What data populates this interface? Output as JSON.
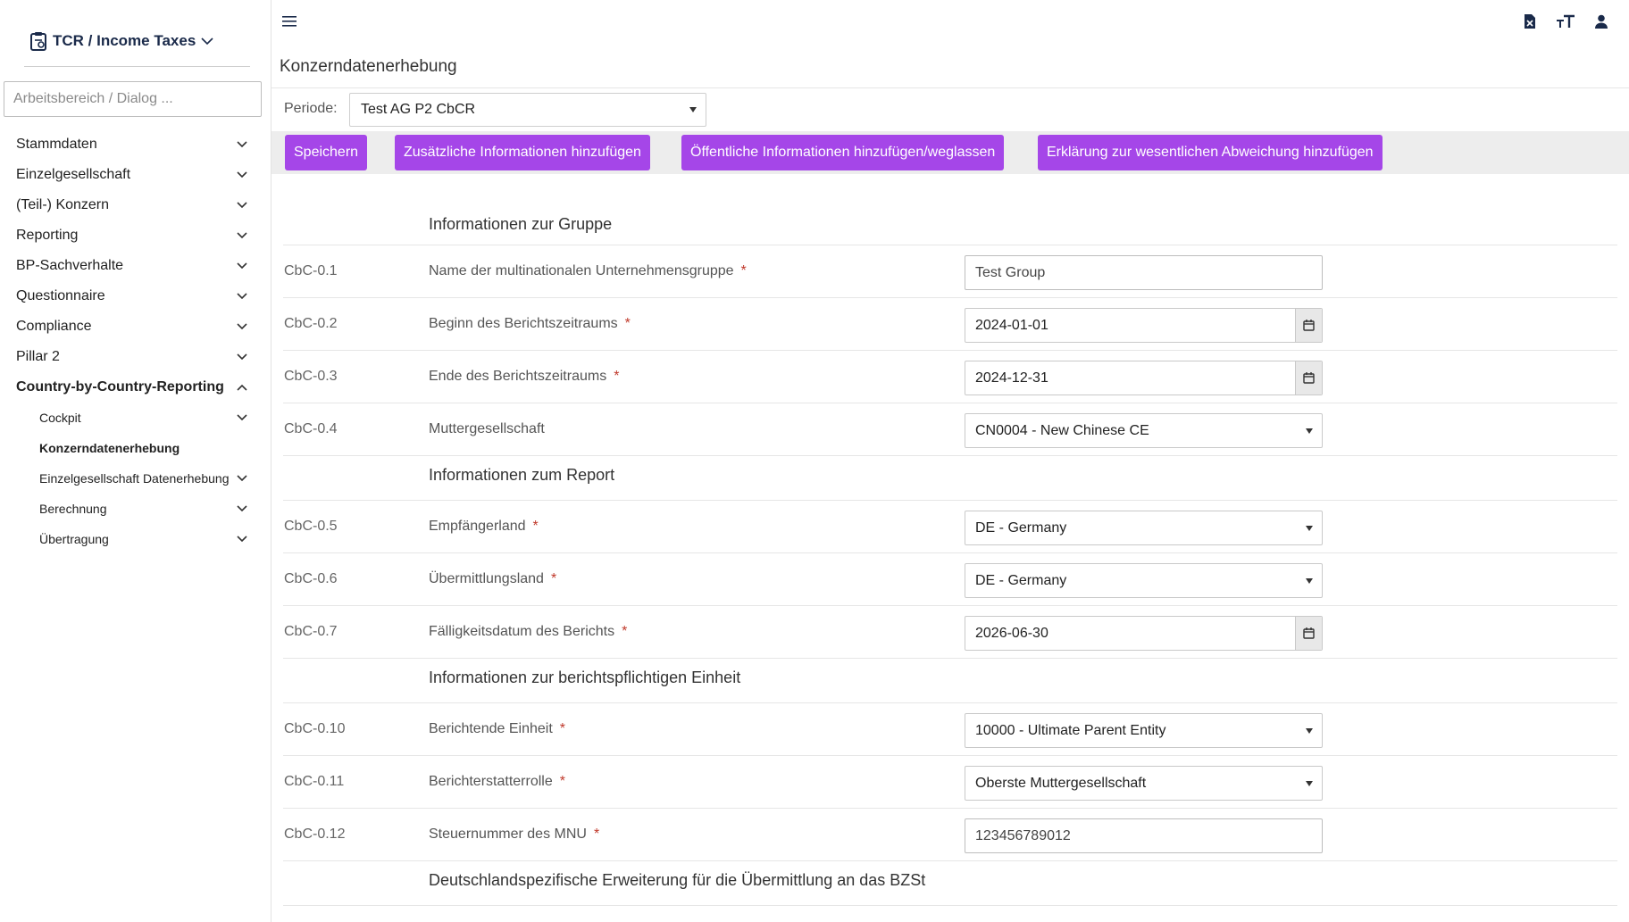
{
  "sidebar": {
    "app_title": "TCR / Income Taxes",
    "search_placeholder": "Arbeitsbereich / Dialog ...",
    "items": [
      {
        "label": "Stammdaten",
        "expanded": false
      },
      {
        "label": "Einzelgesellschaft",
        "expanded": false
      },
      {
        "label": "(Teil-) Konzern",
        "expanded": false
      },
      {
        "label": "Reporting",
        "expanded": false
      },
      {
        "label": "BP-Sachverhalte",
        "expanded": false
      },
      {
        "label": "Questionnaire",
        "expanded": false
      },
      {
        "label": "Compliance",
        "expanded": false
      },
      {
        "label": "Pillar 2",
        "expanded": false
      },
      {
        "label": "Country-by-Country-Reporting",
        "expanded": true
      }
    ],
    "sub_items": [
      {
        "label": "Cockpit"
      },
      {
        "label": "Konzerndatenerhebung"
      },
      {
        "label": "Einzelgesellschaft Datenerhebung"
      },
      {
        "label": "Berechnung"
      },
      {
        "label": "Übertragung"
      }
    ]
  },
  "header": {
    "page_title": "Konzerndatenerhebung",
    "periode_label": "Periode:",
    "periode_value": "Test AG P2 CbCR"
  },
  "toolbar": {
    "save": "Speichern",
    "additional_info": "Zusätzliche Informationen hinzufügen",
    "public_info": "Öffentliche Informationen hinzufügen/weglassen",
    "deviation": "Erklärung zur wesentlichen Abweichung hinzufügen"
  },
  "form": {
    "sections": {
      "group": "Informationen zur Gruppe",
      "report": "Informationen zum Report",
      "entity": "Informationen zur berichtspflichtigen Einheit",
      "germany": "Deutschlandspezifische Erweiterung für die Übermittlung an das BZSt"
    },
    "required_mark": "*",
    "rows": {
      "r01": {
        "code": "CbC-0.1",
        "label": "Name der multinationalen Unternehmensgruppe",
        "value": "Test Group"
      },
      "r02": {
        "code": "CbC-0.2",
        "label": "Beginn des Berichtszeitraums",
        "value": "2024-01-01"
      },
      "r03": {
        "code": "CbC-0.3",
        "label": "Ende des Berichtszeitraums",
        "value": "2024-12-31"
      },
      "r04": {
        "code": "CbC-0.4",
        "label": "Muttergesellschaft",
        "value": "CN0004 - New Chinese CE"
      },
      "r05": {
        "code": "CbC-0.5",
        "label": "Empfängerland",
        "value": "DE - Germany"
      },
      "r06": {
        "code": "CbC-0.6",
        "label": "Übermittlungsland",
        "value": "DE - Germany"
      },
      "r07": {
        "code": "CbC-0.7",
        "label": "Fälligkeitsdatum des Berichts",
        "value": "2026-06-30"
      },
      "r10": {
        "code": "CbC-0.10",
        "label": "Berichtende Einheit",
        "value": "10000 - Ultimate Parent Entity"
      },
      "r11": {
        "code": "CbC-0.11",
        "label": "Berichterstatterrolle",
        "value": "Oberste Muttergesellschaft"
      },
      "r12": {
        "code": "CbC-0.12",
        "label": "Steuernummer des MNU",
        "value": "123456789012"
      }
    }
  }
}
